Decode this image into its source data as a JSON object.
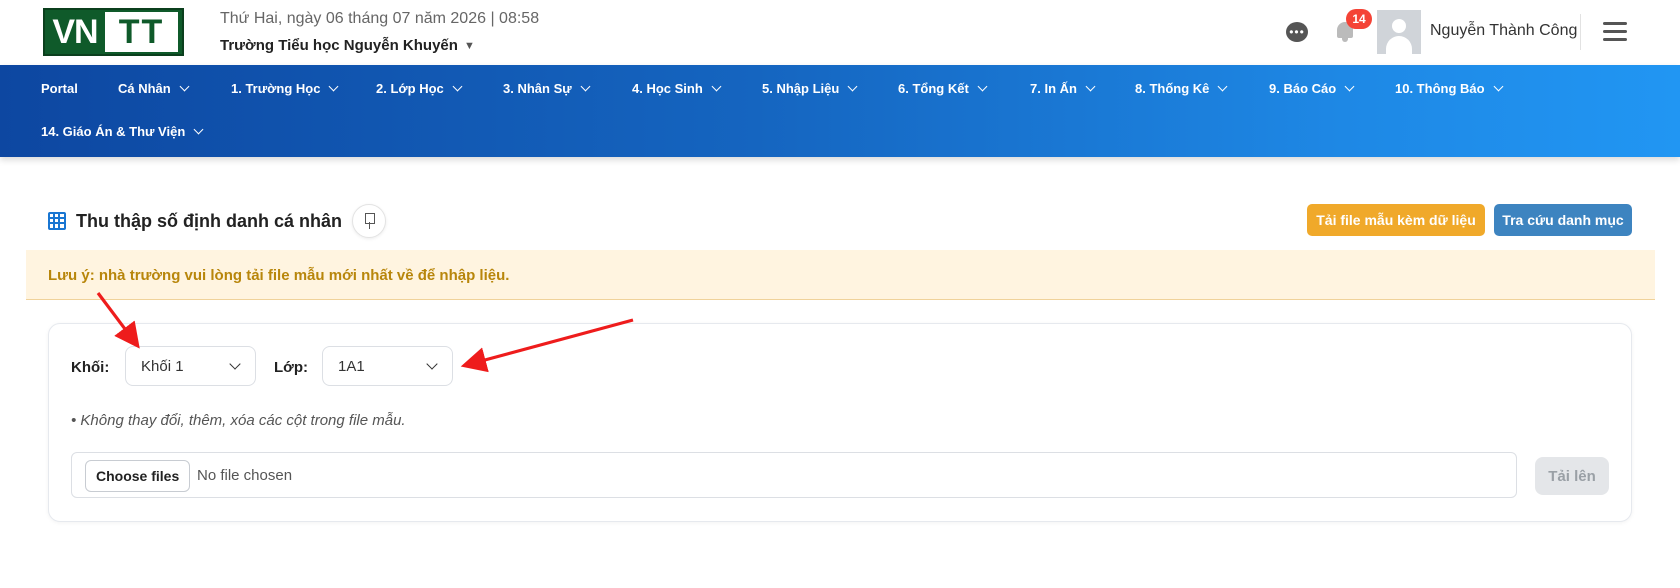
{
  "header": {
    "logo_text_left": "VN",
    "logo_text_right": "TT",
    "date_line": "Thứ Hai, ngày 06 tháng 07 năm 2026 | 08:58",
    "school_name": "Trường Tiểu học Nguyễn Khuyến",
    "notification_count": "14",
    "user_name": "Nguyễn Thành Công"
  },
  "nav": {
    "items": [
      "Portal",
      "Cá Nhân",
      "1. Trường Học",
      "2. Lớp Học",
      "3. Nhân Sự",
      "4. Học Sinh",
      "5. Nhập Liệu",
      "6. Tổng Kết",
      "7. In Ấn",
      "8. Thống Kê",
      "9. Báo Cáo",
      "10. Thông Báo",
      "14. Giáo Án & Thư Viện"
    ]
  },
  "page": {
    "title": "Thu thập số định danh cá nhân",
    "download_template_label": "Tải file mẫu kèm dữ liệu",
    "lookup_label": "Tra cứu danh mục",
    "notice": "Lưu ý: nhà trường vui lòng tải file mẫu mới nhất về để nhập liệu."
  },
  "form": {
    "grade_label": "Khối:",
    "grade_value": "Khối 1",
    "class_label": "Lớp:",
    "class_value": "1A1",
    "hint": "• Không thay đổi, thêm, xóa các cột trong file mẫu.",
    "choose_files_label": "Choose files",
    "no_file_text": "No file chosen",
    "upload_label": "Tải lên"
  },
  "colors": {
    "nav_start": "#0d47a1",
    "nav_end": "#2196f3",
    "download_button": "#f0a92a",
    "lookup_button": "#3d84c0",
    "notice_bg": "#fff4e0",
    "notice_text": "#b8860b",
    "annotation_arrow": "#ee1c1c",
    "badge": "#f44336"
  }
}
